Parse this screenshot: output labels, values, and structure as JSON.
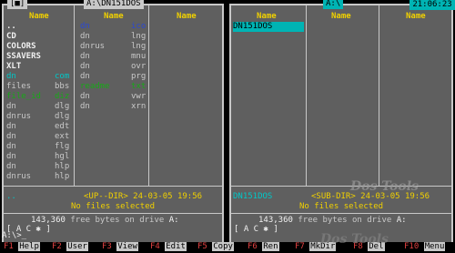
{
  "clock": "21:06:23",
  "left": {
    "title_marker": "[■]",
    "path": "A:\\DN151DOS",
    "col_header": "Name",
    "col1": [
      {
        "name": "..",
        "ext": "",
        "c": "dir"
      },
      {
        "name": "CD",
        "ext": "",
        "c": "dir"
      },
      {
        "name": "COLORS",
        "ext": "",
        "c": "dir"
      },
      {
        "name": "SSAVERS",
        "ext": "",
        "c": "dir"
      },
      {
        "name": "XLT",
        "ext": "",
        "c": "dir"
      },
      {
        "name": "dn",
        "ext": "com",
        "c": "cyan"
      },
      {
        "name": "files",
        "ext": "bbs",
        "c": "ext"
      },
      {
        "name": "file_id",
        "ext": "diz",
        "c": "green"
      },
      {
        "name": "dn",
        "ext": "dlg",
        "c": "ext"
      },
      {
        "name": "dnrus",
        "ext": "dlg",
        "c": "ext"
      },
      {
        "name": "dn",
        "ext": "edt",
        "c": "ext"
      },
      {
        "name": "dn",
        "ext": "ext",
        "c": "ext"
      },
      {
        "name": "dn",
        "ext": "flg",
        "c": "ext"
      },
      {
        "name": "dn",
        "ext": "hgl",
        "c": "ext"
      },
      {
        "name": "dn",
        "ext": "hlp",
        "c": "ext"
      },
      {
        "name": "dnrus",
        "ext": "hlp",
        "c": "ext"
      }
    ],
    "col2": [
      {
        "name": "dn",
        "ext": "ico",
        "c": "blue"
      },
      {
        "name": "dn",
        "ext": "lng",
        "c": "ext"
      },
      {
        "name": "dnrus",
        "ext": "lng",
        "c": "ext"
      },
      {
        "name": "dn",
        "ext": "mnu",
        "c": "ext"
      },
      {
        "name": "dn",
        "ext": "ovr",
        "c": "ext"
      },
      {
        "name": "dn",
        "ext": "prg",
        "c": "ext"
      },
      {
        "name": "readme",
        "ext": "txt",
        "c": "green"
      },
      {
        "name": "dn",
        "ext": "vwr",
        "c": "ext"
      },
      {
        "name": "dn",
        "ext": "xrn",
        "c": "ext"
      }
    ],
    "info_name": "..",
    "info_rest": "<UP--DIR> 24-03-05 19:56",
    "status": "No files selected",
    "free_amount": "143,360",
    "free_text": "free bytes on drive",
    "drive": "A:",
    "ac": "[ A C ✱ ]"
  },
  "right": {
    "path": "A:\\",
    "col_header": "Name",
    "col1": [
      {
        "name": "DN151DOS",
        "ext": "",
        "c": "sel"
      }
    ],
    "info_name": "DN151DOS",
    "info_rest": "<SUB-DIR> 24-03-05 19:56",
    "status": "No files selected",
    "free_amount": "143,360",
    "free_text": "free bytes on drive",
    "drive": "A:",
    "ac": "[ A C ✱ ]"
  },
  "prompt": "A:\\>_",
  "watermark": "Dos Tools",
  "keys": [
    {
      "num": "F1",
      "label": "Help"
    },
    {
      "num": "F2",
      "label": "User"
    },
    {
      "num": "F3",
      "label": "View"
    },
    {
      "num": "F4",
      "label": "Edit"
    },
    {
      "num": "F5",
      "label": "Copy"
    },
    {
      "num": "F6",
      "label": "Ren"
    },
    {
      "num": "F7",
      "label": "MkDir"
    },
    {
      "num": "F8",
      "label": "Del"
    },
    {
      "num": "F10",
      "label": "Menu"
    }
  ]
}
